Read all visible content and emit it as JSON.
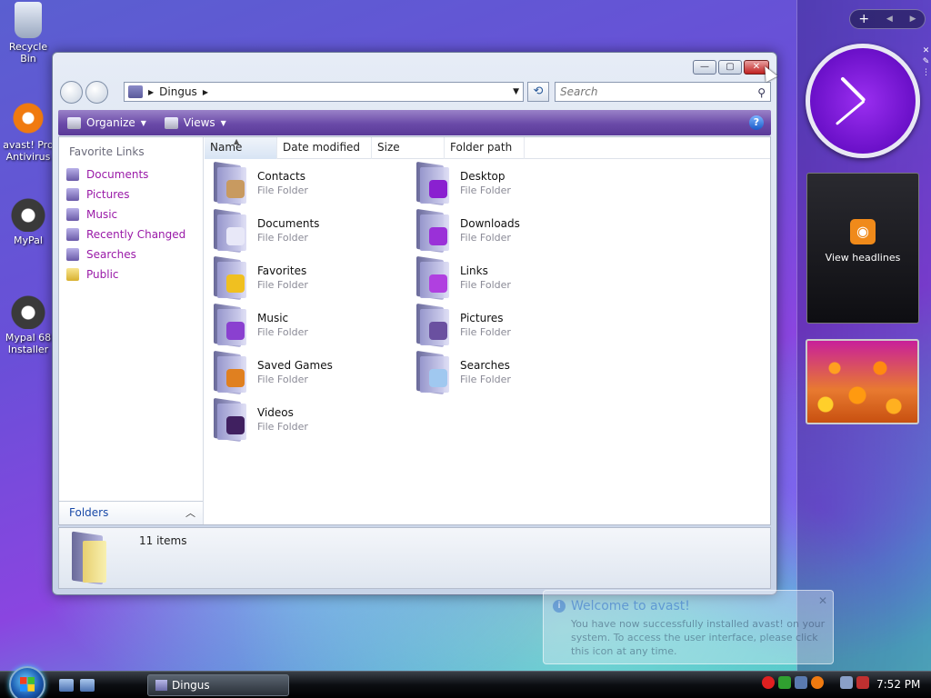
{
  "desktop": {
    "icons": [
      {
        "label": "Recycle Bin",
        "icon": "recycle-bin-icon"
      },
      {
        "label": "avast! Pro Antivirus",
        "icon": "avast-icon"
      },
      {
        "label": "MyPal",
        "icon": "mypal-icon"
      },
      {
        "label": "Mypal 68 Installer",
        "icon": "mypal-installer-icon"
      }
    ]
  },
  "sidebar": {
    "top_controls": {
      "add": "+",
      "prev": "◀",
      "next": "▶"
    },
    "feed_label": "View headlines"
  },
  "window": {
    "controls": {
      "minimize": "—",
      "maximize": "▢",
      "close": "✕"
    },
    "address": {
      "crumb": "Dingus",
      "sep": "▶"
    },
    "search": {
      "placeholder": "Search"
    },
    "toolbar": {
      "organize": "Organize",
      "views": "Views",
      "help": "?"
    },
    "favorite_links": {
      "title": "Favorite Links",
      "items": [
        {
          "label": "Documents",
          "icon": "documents-icon"
        },
        {
          "label": "Pictures",
          "icon": "pictures-icon"
        },
        {
          "label": "Music",
          "icon": "music-icon"
        },
        {
          "label": "Recently Changed",
          "icon": "recently-changed-icon"
        },
        {
          "label": "Searches",
          "icon": "searches-icon"
        },
        {
          "label": "Public",
          "icon": "public-folder-icon"
        }
      ]
    },
    "folders_label": "Folders",
    "columns": [
      "Name",
      "Date modified",
      "Size",
      "Folder path"
    ],
    "items": [
      {
        "name": "Contacts",
        "type": "File Folder",
        "icon": "contacts-folder-icon",
        "accent": "#c89a60"
      },
      {
        "name": "Desktop",
        "type": "File Folder",
        "icon": "desktop-folder-icon",
        "accent": "#8a20d0"
      },
      {
        "name": "Documents",
        "type": "File Folder",
        "icon": "documents-folder-icon",
        "accent": "#e8e8f8"
      },
      {
        "name": "Downloads",
        "type": "File Folder",
        "icon": "downloads-folder-icon",
        "accent": "#9a30d8"
      },
      {
        "name": "Favorites",
        "type": "File Folder",
        "icon": "favorites-folder-icon",
        "accent": "#f0c020"
      },
      {
        "name": "Links",
        "type": "File Folder",
        "icon": "links-folder-icon",
        "accent": "#b040e0"
      },
      {
        "name": "Music",
        "type": "File Folder",
        "icon": "music-folder-icon",
        "accent": "#8a40d0"
      },
      {
        "name": "Pictures",
        "type": "File Folder",
        "icon": "pictures-folder-icon",
        "accent": "#6a50a0"
      },
      {
        "name": "Saved Games",
        "type": "File Folder",
        "icon": "saved-games-folder-icon",
        "accent": "#e08020"
      },
      {
        "name": "Searches",
        "type": "File Folder",
        "icon": "searches-folder-icon",
        "accent": "#a0c8f0"
      },
      {
        "name": "Videos",
        "type": "File Folder",
        "icon": "videos-folder-icon",
        "accent": "#402060"
      }
    ],
    "details": {
      "count": "11 items"
    }
  },
  "popup": {
    "title": "Welcome to avast!",
    "body": "You have now successfully installed avast! on your system. To access the user interface, please click this icon at any time.",
    "close": "✕"
  },
  "taskbar": {
    "task_label": "Dingus",
    "time": "7:52 PM"
  }
}
